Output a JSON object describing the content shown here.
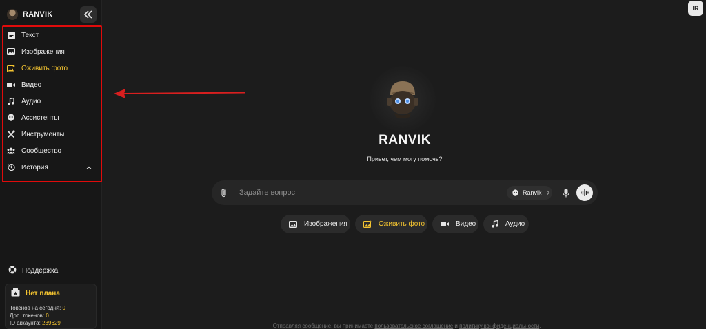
{
  "app": {
    "name": "RANVIK",
    "user_initials": "IR"
  },
  "sidebar": {
    "items": [
      {
        "label": "Текст",
        "icon": "text-icon"
      },
      {
        "label": "Изображения",
        "icon": "image-icon"
      },
      {
        "label": "Оживить фото",
        "icon": "animate-photo-icon",
        "active": true
      },
      {
        "label": "Видео",
        "icon": "video-icon"
      },
      {
        "label": "Аудио",
        "icon": "music-icon"
      },
      {
        "label": "Ассистенты",
        "icon": "assistant-icon"
      },
      {
        "label": "Инструменты",
        "icon": "tools-icon"
      },
      {
        "label": "Сообщество",
        "icon": "community-icon"
      },
      {
        "label": "История",
        "icon": "history-icon"
      }
    ],
    "support_label": "Поддержка",
    "plan": {
      "title": "Нет плана",
      "tokens_today_label": "Токенов на сегодня:",
      "tokens_today_value": "0",
      "extra_tokens_label": "Доп. токенов:",
      "extra_tokens_value": "0",
      "account_id_label": "ID аккаунта:",
      "account_id_value": "239629"
    }
  },
  "main": {
    "title": "RANVIK",
    "subtitle": "Привет, чем могу помочь?",
    "chat": {
      "placeholder": "Задайте вопрос",
      "model_label": "Ranvik"
    },
    "chips": [
      {
        "label": "Изображения",
        "icon": "image-icon"
      },
      {
        "label": "Оживить фото",
        "icon": "animate-photo-icon",
        "active": true
      },
      {
        "label": "Видео",
        "icon": "video-icon"
      },
      {
        "label": "Аудио",
        "icon": "music-icon"
      }
    ],
    "footer": {
      "prefix": "Отправляя сообщение, вы принимаете",
      "link1": "пользовательское соглашение",
      "middle": "и",
      "link2": "политику конфиденциальности",
      "suffix": "."
    }
  },
  "colors": {
    "accent": "#f4c430",
    "highlight_border": "#e00b0b",
    "arrow": "#d81f1f",
    "background": "#1c1c1c",
    "sidebar": "#171717"
  }
}
